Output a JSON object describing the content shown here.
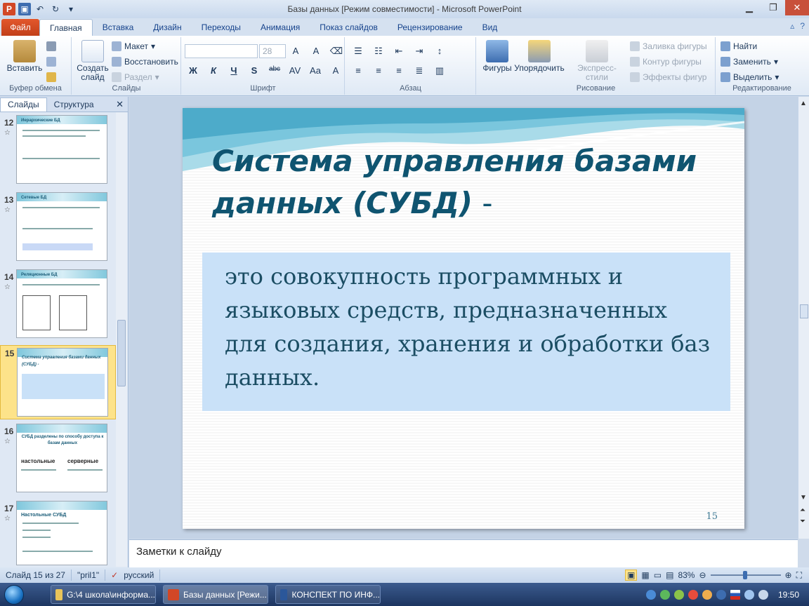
{
  "window": {
    "title": "Базы данных [Режим совместимости]  -  Microsoft PowerPoint"
  },
  "tabs": [
    "Файл",
    "Главная",
    "Вставка",
    "Дизайн",
    "Переходы",
    "Анимация",
    "Показ слайдов",
    "Рецензирование",
    "Вид"
  ],
  "ribbon": {
    "clipboard": {
      "paste": "Вставить",
      "label": "Буфер обмена"
    },
    "slides": {
      "new_slide": "Создать слайд",
      "layout": "Макет",
      "reset": "Восстановить",
      "section": "Раздел",
      "label": "Слайды"
    },
    "font": {
      "size": "28",
      "label": "Шрифт",
      "bold": "Ж",
      "italic": "К",
      "underline": "Ч",
      "shadow": "S",
      "strike": "abc"
    },
    "paragraph": {
      "label": "Абзац"
    },
    "drawing": {
      "shapes": "Фигуры",
      "arrange": "Упорядочить",
      "styles": "Экспресс-стили",
      "fill": "Заливка фигуры",
      "outline": "Контур фигуры",
      "effects": "Эффекты фигур",
      "label": "Рисование"
    },
    "editing": {
      "find": "Найти",
      "replace": "Заменить",
      "select": "Выделить",
      "label": "Редактирование"
    }
  },
  "left_pane": {
    "tab_slides": "Слайды",
    "tab_outline": "Структура",
    "close": "✕",
    "thumbnails": [
      {
        "num": "12",
        "title": "Иерархические БД"
      },
      {
        "num": "13",
        "title": "Сетевые БД"
      },
      {
        "num": "14",
        "title": "Реляционные БД"
      },
      {
        "num": "15",
        "title": "Система управления базами данных (СУБД) -",
        "selected": true
      },
      {
        "num": "16",
        "title": "СУБД разделены по способу доступа к базам данных",
        "sub1": "настольные",
        "sub2": "серверные"
      },
      {
        "num": "17",
        "title": "Настольные СУБД"
      }
    ]
  },
  "slide": {
    "title": "Система управления базами данных (СУБД)",
    "title_dash": " -",
    "body": " это совокупность программных и языковых средств, предназначенных для создания, хранения и обработки баз данных.",
    "number": "15"
  },
  "notes": {
    "placeholder": "Заметки к слайду"
  },
  "status": {
    "slide_pos": "Слайд 15 из 27",
    "theme": "\"pril1\"",
    "language": "русский",
    "zoom": "83%",
    "zoom_value": 83
  },
  "taskbar": {
    "items": [
      {
        "label": "G:\\4 школа\\информа..."
      },
      {
        "label": "Базы данных [Режи..."
      },
      {
        "label": "КОНСПЕКТ ПО ИНФ..."
      }
    ],
    "clock": "19:50"
  },
  "colors": {
    "slide_title": "#0f5470",
    "slide_box": "#c9e1f8",
    "file_tab": "#d24726"
  }
}
